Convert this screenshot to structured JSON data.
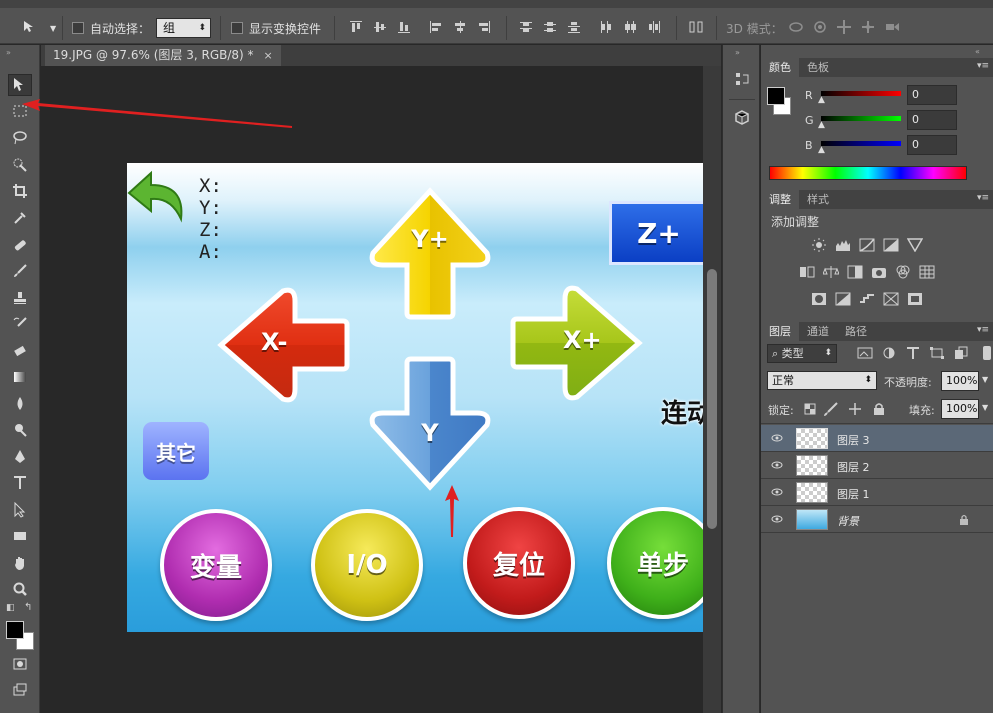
{
  "optionbar": {
    "auto_select_label": "自动选择：",
    "auto_select_value": "组",
    "show_transform_label": "显示变换控件",
    "mode_3d_label": "3D 模式："
  },
  "document": {
    "tab_title": "19.JPG @ 97.6% (图层 3, RGB/8) *",
    "close": "×"
  },
  "image": {
    "coords": [
      "X:",
      "Y:",
      "Z:",
      "A:"
    ],
    "y_plus": "Y+",
    "y_minus": "Y",
    "x_minus": "X-",
    "x_plus": "X+",
    "z_plus": "Z+",
    "other": "其它",
    "linkage": "连动",
    "variable": "变量",
    "io": "I/O",
    "reset": "复位",
    "step": "单步"
  },
  "color_panel": {
    "tabs": [
      "颜色",
      "色板"
    ],
    "r_label": "R",
    "g_label": "G",
    "b_label": "B",
    "r_value": "0",
    "g_value": "0",
    "b_value": "0"
  },
  "adjust_panel": {
    "tabs": [
      "调整",
      "样式"
    ],
    "title": "添加调整"
  },
  "layers_panel": {
    "tabs": [
      "图层",
      "通道",
      "路径"
    ],
    "filter_label": "类型",
    "blend_mode": "正常",
    "opacity_label": "不透明度:",
    "opacity_value": "100%",
    "lock_label": "锁定:",
    "fill_label": "填充:",
    "fill_value": "100%",
    "layers": [
      {
        "name": "图层 3",
        "selected": true
      },
      {
        "name": "图层 2",
        "selected": false
      },
      {
        "name": "图层 1",
        "selected": false
      },
      {
        "name": "背景",
        "selected": false
      }
    ]
  },
  "colors": {
    "accent_selection": "#5b6877",
    "annotation_arrow": "#e02020"
  }
}
